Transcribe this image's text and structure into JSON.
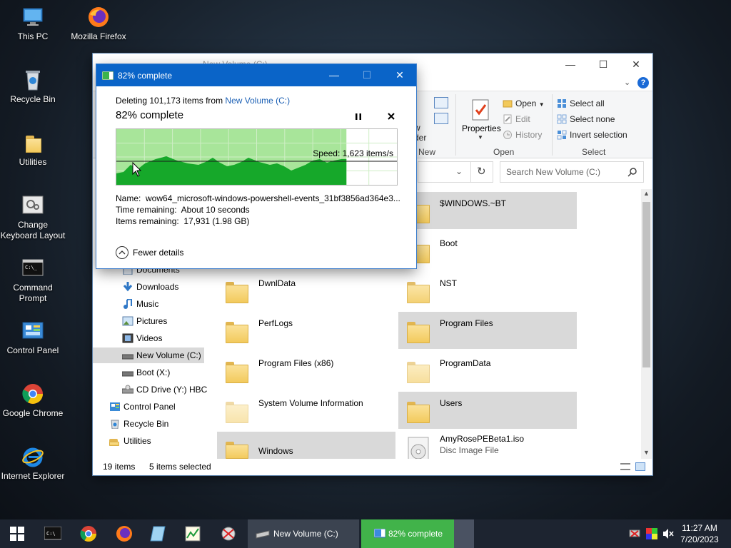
{
  "desktop": {
    "icons": [
      {
        "label": "This PC"
      },
      {
        "label": "Mozilla Firefox"
      },
      {
        "label": "Recycle Bin"
      },
      {
        "label": "Utilities"
      },
      {
        "label": "Change Keyboard Layout"
      },
      {
        "label": "Command Prompt"
      },
      {
        "label": "Control Panel"
      },
      {
        "label": "Google Chrome"
      },
      {
        "label": "Internet Explorer"
      }
    ]
  },
  "explorer": {
    "title": "New Volume (C:)",
    "ribbon": {
      "groups": {
        "new": "New",
        "open": "Open",
        "select": "Select"
      },
      "new_partial": "w",
      "new_partial2": "der",
      "properties": "Properties",
      "open": "Open",
      "edit": "Edit",
      "history": "History",
      "select_all": "Select all",
      "select_none": "Select none",
      "invert_selection": "Invert selection"
    },
    "search_placeholder": "Search New Volume (C:)",
    "nav": [
      {
        "label": "Documents"
      },
      {
        "label": "Downloads"
      },
      {
        "label": "Music"
      },
      {
        "label": "Pictures"
      },
      {
        "label": "Videos"
      },
      {
        "label": "New Volume (C:)"
      },
      {
        "label": "Boot (X:)"
      },
      {
        "label": "CD Drive (Y:) HBC"
      },
      {
        "label": "Control Panel"
      },
      {
        "label": "Recycle Bin"
      },
      {
        "label": "Utilities"
      }
    ],
    "files": [
      {
        "name": "$WINDOWS.~BT"
      },
      {
        "name": "Boot"
      },
      {
        "name": "DwnlData"
      },
      {
        "name": "NST"
      },
      {
        "name": "PerfLogs"
      },
      {
        "name": "Program Files"
      },
      {
        "name": "Program Files (x86)"
      },
      {
        "name": "ProgramData"
      },
      {
        "name": "System Volume Information"
      },
      {
        "name": "Users"
      },
      {
        "name": "Windows"
      },
      {
        "name": "AmyRosePEBeta1.iso",
        "type": "Disc Image File"
      }
    ],
    "status": {
      "count": "19 items",
      "selected": "5 items selected"
    }
  },
  "dialog": {
    "title": "82% complete",
    "deleting_prefix": "Deleting 101,173 items from ",
    "deleting_link": "New Volume (C:)",
    "percent": "82% complete",
    "progress": 0.82,
    "speed": "Speed: 1,623 items/s",
    "name_label": "Name:",
    "name_value": "wow64_microsoft-windows-powershell-events_31bf3856ad364e3...",
    "time_label": "Time remaining:",
    "time_value": "About 10 seconds",
    "items_label": "Items remaining:",
    "items_value": "17,931 (1.98 GB)",
    "fewer_details": "Fewer details"
  },
  "taskbar": {
    "tasks": [
      {
        "label": "New Volume (C:)"
      },
      {
        "label": "82% complete"
      }
    ],
    "time": "11:27 AM",
    "date": "7/20/2023"
  },
  "colors": {
    "accent": "#0a64c8",
    "graph_fill": "#16a82a",
    "graph_bg": "#a8e59a",
    "taskbar": "#1d2430"
  }
}
